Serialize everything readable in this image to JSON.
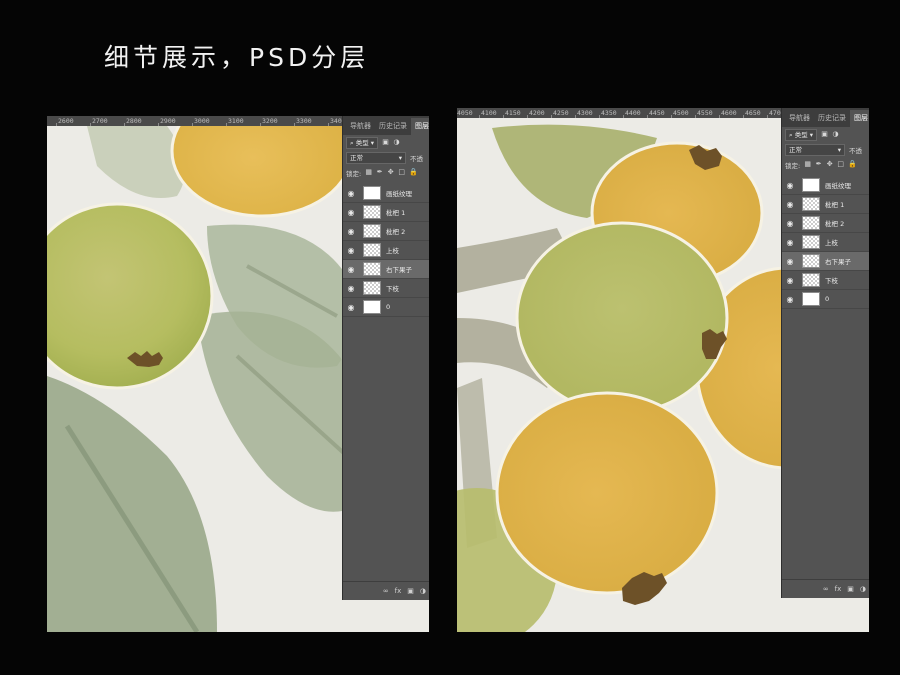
{
  "header": {
    "title": "细节展示，PSD分层"
  },
  "left_shot": {
    "ruler_ticks": [
      "2600",
      "2700",
      "2800",
      "2900",
      "3000",
      "3100",
      "3200",
      "3300",
      "3400"
    ],
    "panel": {
      "tabs": [
        "导航器",
        "历史记录",
        "图层"
      ],
      "filter_label": "类型",
      "blend_mode": "正常",
      "opacity_label": "不透",
      "lock_label": "锁定:",
      "layers": [
        {
          "name": "画纸纹理",
          "visible": true,
          "thumb": "white"
        },
        {
          "name": "枇杷 1",
          "visible": true,
          "thumb": "checker"
        },
        {
          "name": "枇杷 2",
          "visible": true,
          "thumb": "checker"
        },
        {
          "name": "上枝",
          "visible": true,
          "thumb": "checker"
        },
        {
          "name": "右下果子",
          "visible": true,
          "thumb": "checker",
          "selected": true
        },
        {
          "name": "下枝",
          "visible": true,
          "thumb": "checker"
        },
        {
          "name": "0",
          "visible": true,
          "thumb": "white"
        }
      ],
      "bottom_icons": [
        "link-icon",
        "fx",
        "mask-icon",
        "adjustment-icon"
      ]
    }
  },
  "right_shot": {
    "ruler_ticks": [
      "4050",
      "4100",
      "4150",
      "4200",
      "4250",
      "4300",
      "4350",
      "4400",
      "4450",
      "4500",
      "4550",
      "4600",
      "4650",
      "4700",
      "4750",
      "4800",
      "4850"
    ],
    "panel": {
      "tabs": [
        "导航器",
        "历史记录",
        "图层"
      ],
      "filter_label": "类型",
      "blend_mode": "正常",
      "opacity_label": "不透",
      "lock_label": "锁定:",
      "layers": [
        {
          "name": "画纸纹理",
          "visible": true,
          "thumb": "white"
        },
        {
          "name": "枇杷 1",
          "visible": true,
          "thumb": "checker"
        },
        {
          "name": "枇杷 2",
          "visible": true,
          "thumb": "checker"
        },
        {
          "name": "上枝",
          "visible": true,
          "thumb": "checker"
        },
        {
          "name": "右下果子",
          "visible": true,
          "thumb": "checker",
          "selected": true
        },
        {
          "name": "下枝",
          "visible": true,
          "thumb": "checker"
        },
        {
          "name": "0",
          "visible": true,
          "thumb": "white"
        }
      ],
      "bottom_icons": [
        "link-icon",
        "fx",
        "mask-icon",
        "adjustment-icon"
      ]
    }
  },
  "colors": {
    "background": "#050505",
    "paper": "#ecebe6",
    "leaf": "#a9b59a",
    "loquat_green": "#bcc36e",
    "loquat_yellow": "#e3b44a",
    "stem": "#a2a08e",
    "calyx": "#6d5128",
    "panel": "#535353"
  }
}
